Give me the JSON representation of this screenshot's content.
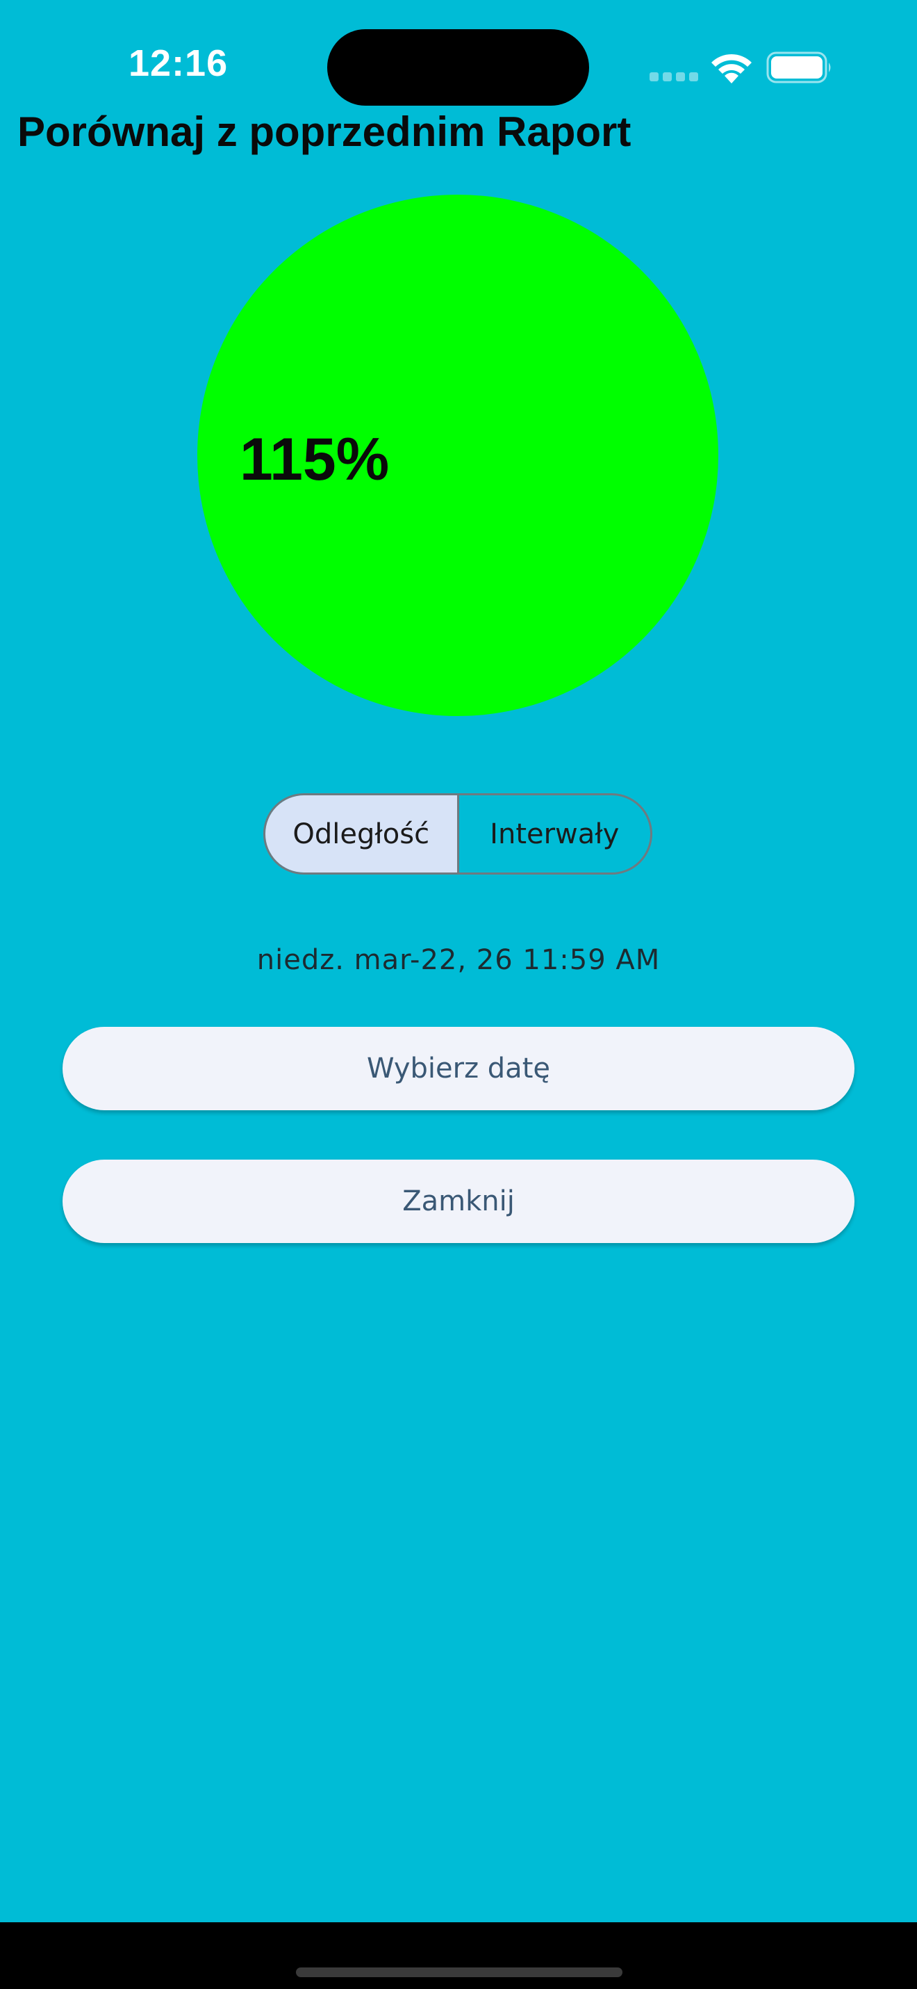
{
  "status_bar": {
    "time": "12:16",
    "icons": [
      "cellular-signal-icon",
      "wifi-icon",
      "battery-icon"
    ]
  },
  "header": {
    "title": "Porównaj z poprzednim Raport"
  },
  "chart_data": {
    "type": "pie",
    "values": [
      100
    ],
    "colors": [
      "#00FF00"
    ],
    "data_label": "115%",
    "title": ""
  },
  "toggle": {
    "options": [
      "Odległość",
      "Interwały"
    ],
    "selected": "Odległość"
  },
  "date_display": "niedz. mar-22, 26 11:59 AM",
  "buttons": {
    "pick_date": "Wybierz datę",
    "close": "Zamknij"
  },
  "colors": {
    "background": "#00BCD6",
    "chart_fill": "#00FF00",
    "button_bg": "#F1F3FA",
    "button_text": "#3A5875",
    "toggle_selected": "#D7E3F7"
  }
}
